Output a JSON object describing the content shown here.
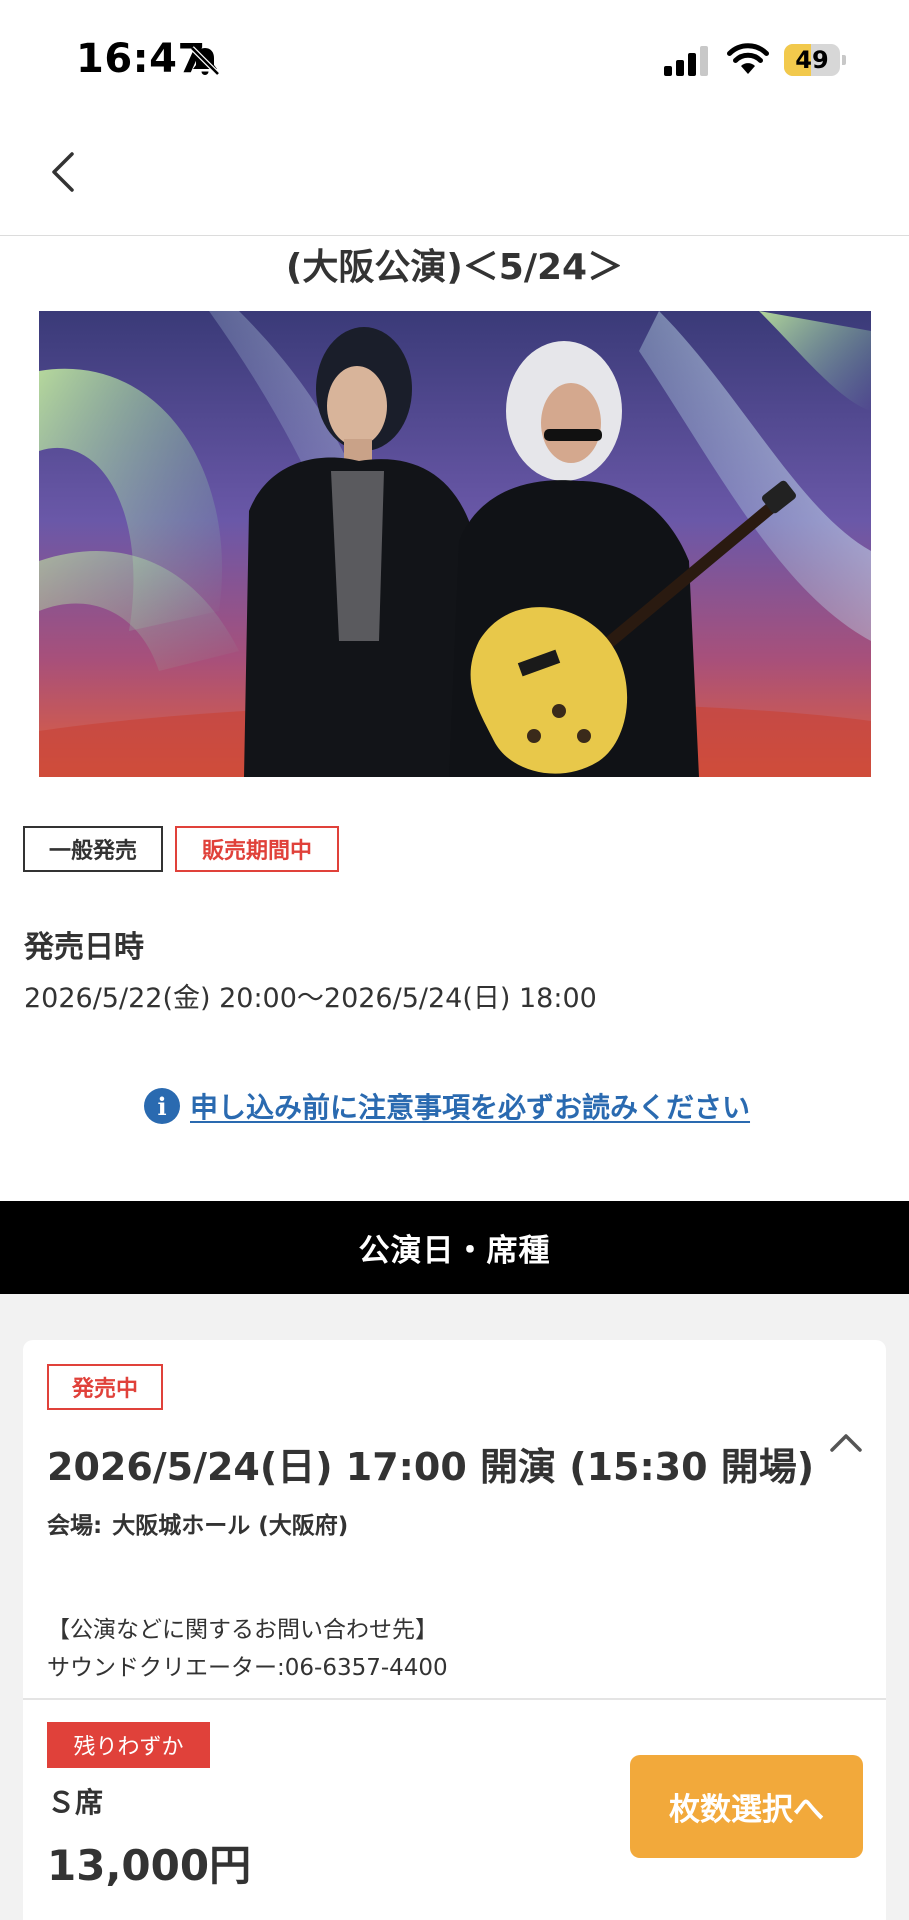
{
  "status_bar": {
    "time": "16:47",
    "battery_level": "49",
    "battery_fraction": 0.49,
    "icons": [
      "bell-slash-icon",
      "signal-icon",
      "wifi-icon",
      "battery-icon"
    ]
  },
  "nav": {
    "back_icon": "chevron-left-icon"
  },
  "page": {
    "title": "(大阪公演)＜5/24＞"
  },
  "hero": {
    "icon": "artist-photo"
  },
  "tags": {
    "general": "一般発売",
    "sale_status": "販売期間中"
  },
  "sale": {
    "heading": "発売日時",
    "period": "2026/5/22(金) 20:00〜2026/5/24(日) 18:00"
  },
  "notice": {
    "icon": "info-icon",
    "icon_glyph": "i",
    "text": "申し込み前に注意事項を必ずお読みください"
  },
  "section": {
    "title": "公演日・席種"
  },
  "performance": {
    "status": "発売中",
    "date": "2026/5/24(日) 17:00 開演 (15:30 開場)",
    "venue_label": "会場:",
    "venue_name": "大阪城ホール (大阪府)",
    "contact_heading": "【公演などに関するお問い合わせ先】",
    "contact_phone": "サウンドクリエーター:06-6357-4400",
    "collapse_icon": "chevron-up-icon"
  },
  "seat": {
    "availability": "残りわずか",
    "name": "Ｓ席",
    "price": "13,000円",
    "select_label": "枚数選択へ"
  },
  "colors": {
    "accent_red": "#e0413a",
    "link_blue": "#2a6ab0",
    "button_orange": "#f2a93b",
    "battery_yellow": "#f2c94c"
  }
}
